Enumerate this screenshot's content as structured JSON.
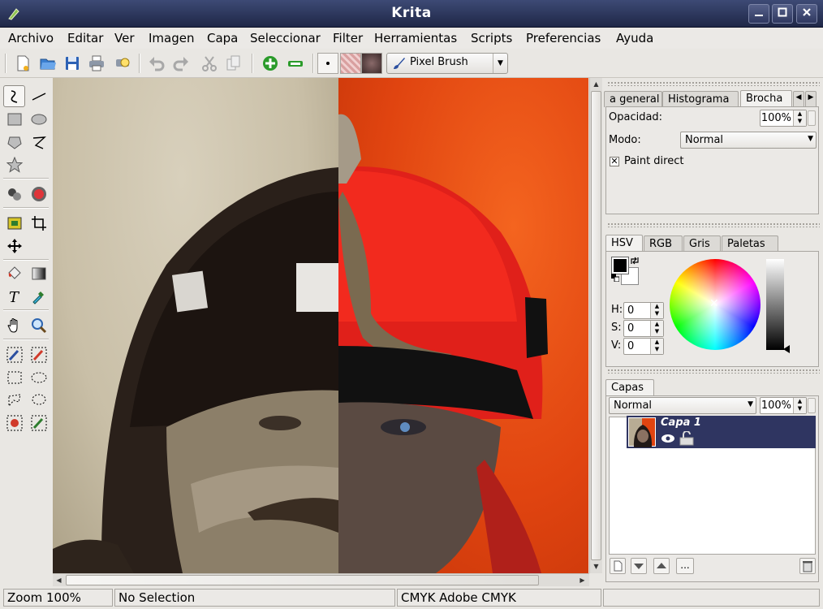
{
  "window": {
    "title": "Krita"
  },
  "menu": [
    "Archivo",
    "Editar",
    "Ver",
    "Imagen",
    "Capa",
    "Seleccionar",
    "Filter",
    "Herramientas",
    "Scripts",
    "Preferencias",
    "Ayuda"
  ],
  "toolbar": {
    "brush_label": "Pixel Brush"
  },
  "brush_panel": {
    "tabs": [
      "a general",
      "Histograma",
      "Brocha"
    ],
    "opacity_label": "Opacidad:",
    "opacity_value": "100%",
    "mode_label": "Modo:",
    "mode_value": "Normal",
    "paint_direct_label": "Paint direct",
    "paint_direct_checked": true
  },
  "color_panel": {
    "tabs": [
      "HSV",
      "RGB",
      "Gris",
      "Paletas"
    ],
    "h_label": "H:",
    "h_value": "0",
    "s_label": "S:",
    "s_value": "0",
    "v_label": "V:",
    "v_value": "0"
  },
  "layers_panel": {
    "tab": "Capas",
    "mode_value": "Normal",
    "opacity_value": "100%",
    "layer_name": "Capa 1",
    "more_label": "..."
  },
  "status": {
    "zoom": "Zoom 100%",
    "selection": "No Selection",
    "colorspace": "CMYK  Adobe CMYK"
  },
  "colors": {
    "titlebar": "#2a335a",
    "layer_selected": "#2f3561",
    "canvas_left": "#c9bfa7",
    "canvas_right": "#e04410"
  }
}
